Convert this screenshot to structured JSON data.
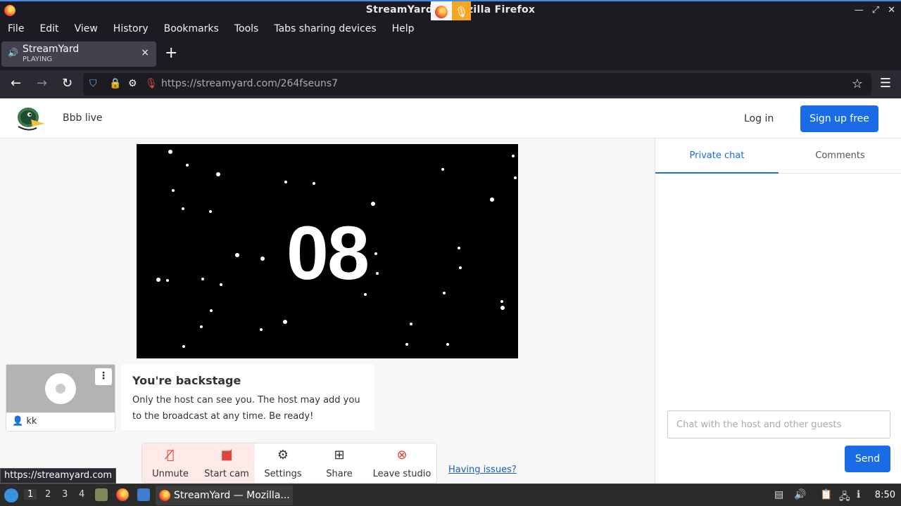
{
  "window": {
    "title": "StreamYard — Mozilla Firefox",
    "title_display": "StreamYard — Mozilla Firefox"
  },
  "menu": [
    "File",
    "Edit",
    "View",
    "History",
    "Bookmarks",
    "Tools",
    "Tabs sharing devices",
    "Help"
  ],
  "tab": {
    "title": "StreamYard",
    "subtitle": "PLAYING",
    "close": "×"
  },
  "nav": {
    "url_host": "https://streamyard.com",
    "url_path": "/264fseuns7"
  },
  "site": {
    "broadcast_name": "Bbb live",
    "login": "Log in",
    "signup": "Sign up free"
  },
  "stage": {
    "countdown": "08"
  },
  "self": {
    "name": "kk"
  },
  "backstage": {
    "heading": "You're backstage",
    "text": "Only the host can see you. The host may add you to the broadcast at any time. Be ready!"
  },
  "controls": {
    "unmute": "Unmute",
    "start_cam": "Start cam",
    "settings": "Settings",
    "share": "Share",
    "leave": "Leave studio",
    "issues": "Having issues?"
  },
  "chat": {
    "tab_private": "Private chat",
    "tab_comments": "Comments",
    "placeholder": "Chat with the host and other guests",
    "send": "Send"
  },
  "status_link": "https://streamyard.com",
  "taskbar": {
    "workspaces": [
      "1",
      "2",
      "3",
      "4"
    ],
    "task_label": "StreamYard — Mozilla...",
    "clock": "8:50"
  },
  "colors": {
    "accent": "#1a6ce6",
    "danger": "#e0443a"
  }
}
